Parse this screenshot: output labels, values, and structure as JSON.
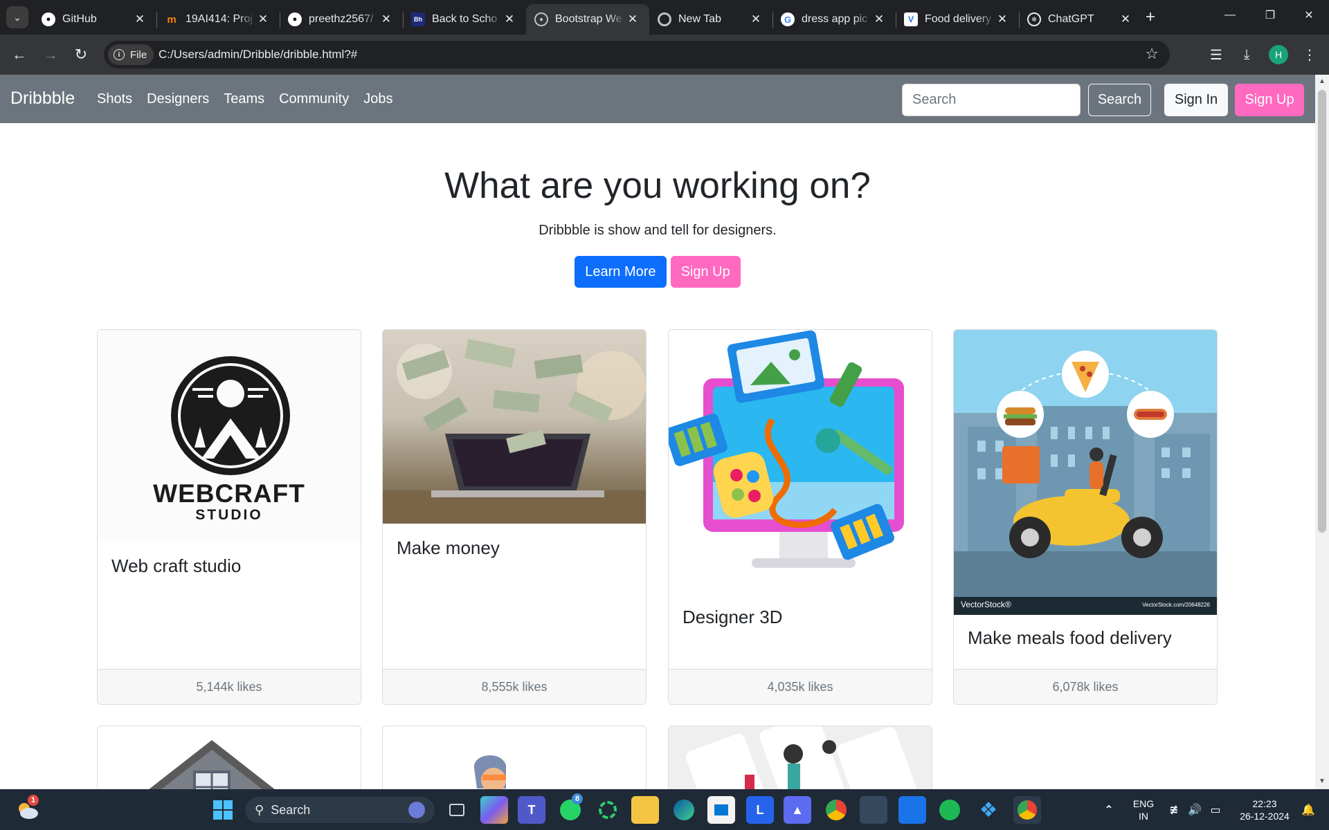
{
  "browser": {
    "tabs": [
      {
        "title": "GitHub",
        "icon": "github-icon"
      },
      {
        "title": "19AI414: Proj",
        "icon": "moodle-icon"
      },
      {
        "title": "preethz2567/",
        "icon": "github-icon"
      },
      {
        "title": "Back to Scho",
        "icon": "behance-icon"
      },
      {
        "title": "Bootstrap We",
        "icon": "globe-icon",
        "active": true
      },
      {
        "title": "New Tab",
        "icon": "chrome-icon"
      },
      {
        "title": "dress app pic",
        "icon": "google-icon"
      },
      {
        "title": "Food delivery",
        "icon": "vectorstock-icon"
      },
      {
        "title": "ChatGPT",
        "icon": "chatgpt-icon"
      }
    ],
    "file_chip": "File",
    "url": "C:/Users/admin/Dribble/dribble.html?#",
    "profile_initial": "H"
  },
  "site": {
    "brand": "Dribbble",
    "nav": [
      "Shots",
      "Designers",
      "Teams",
      "Community",
      "Jobs"
    ],
    "search_placeholder": "Search",
    "search_button": "Search",
    "signin": "Sign In",
    "signup": "Sign Up"
  },
  "hero": {
    "title": "What are you working on?",
    "subtitle": "Dribbble is show and tell for designers.",
    "learn_more": "Learn More",
    "signup": "Sign Up"
  },
  "cards": [
    {
      "title": "Web craft studio",
      "likes": "5,144k likes",
      "logo_line1": "WEBCRAFT",
      "logo_line2": "STUDIO"
    },
    {
      "title": "Make money",
      "likes": "8,555k likes"
    },
    {
      "title": "Designer 3D",
      "likes": "4,035k likes"
    },
    {
      "title": "Make meals food delivery",
      "likes": "6,078k likes",
      "watermark": "VectorStock®",
      "watermark_url": "VectorStock.com/20648226"
    }
  ],
  "taskbar": {
    "search": "Search",
    "weather_badge": "1",
    "whatsapp_badge": "8",
    "lang_line1": "ENG",
    "lang_line2": "IN",
    "time": "22:23",
    "date": "26-12-2024"
  },
  "colors": {
    "navbar": "#6c757d",
    "primary": "#0d6efd",
    "pink": "#ff69c0"
  }
}
